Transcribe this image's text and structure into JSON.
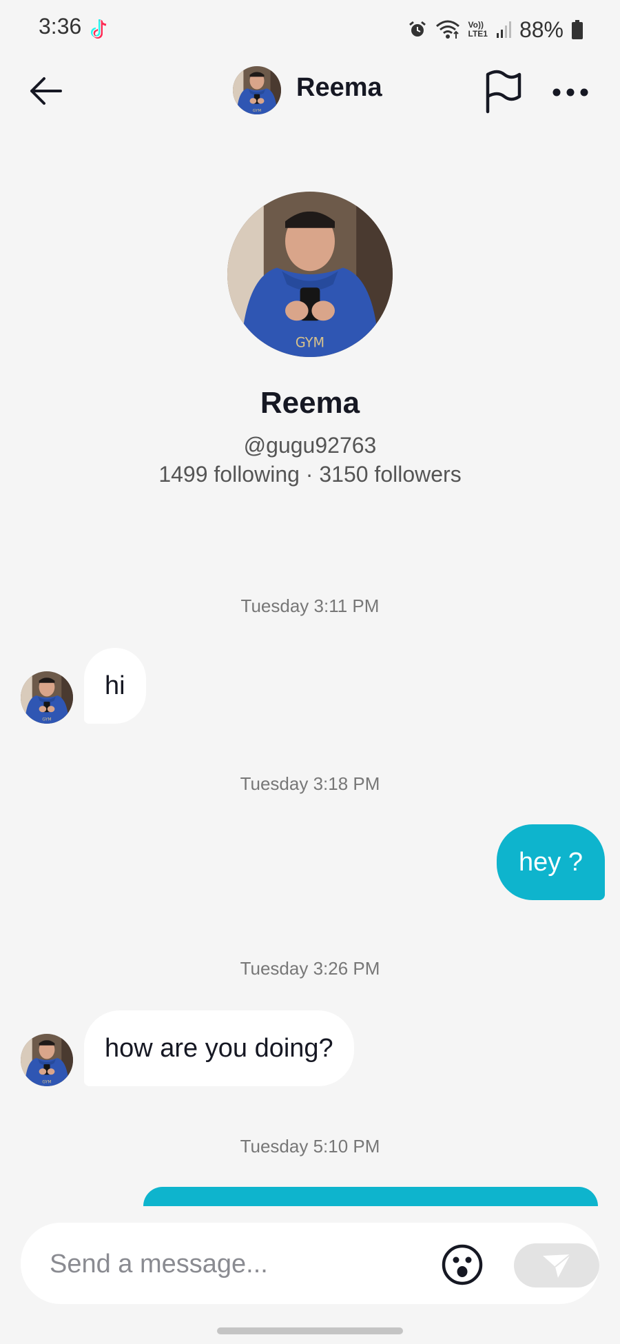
{
  "status_bar": {
    "time": "3:36",
    "battery": "88%",
    "lte_top": "Vo))",
    "lte_bottom": "LTE1"
  },
  "header": {
    "title": "Reema",
    "back_icon": "arrow-left-icon",
    "flag_icon": "flag-icon",
    "more_icon": "more-horizontal-icon"
  },
  "profile": {
    "name": "Reema",
    "handle": "@gugu92763",
    "stats": "1499 following · 3150 followers"
  },
  "messages": [
    {
      "timestamp": "Tuesday 3:11 PM",
      "direction": "incoming",
      "text": "hi"
    },
    {
      "timestamp": "Tuesday 3:18 PM",
      "direction": "outgoing",
      "text": "hey ?"
    },
    {
      "timestamp": "Tuesday 3:26 PM",
      "direction": "incoming",
      "text": "how are you doing?"
    },
    {
      "timestamp": "Tuesday 5:10 PM",
      "direction": "outgoing",
      "text": ""
    }
  ],
  "composer": {
    "placeholder": "Send a message...",
    "emoji_icon": "emoji-icon",
    "send_icon": "send-icon"
  },
  "colors": {
    "accent": "#0eb4cd",
    "background": "#f5f5f5",
    "bubble_incoming": "#ffffff"
  }
}
